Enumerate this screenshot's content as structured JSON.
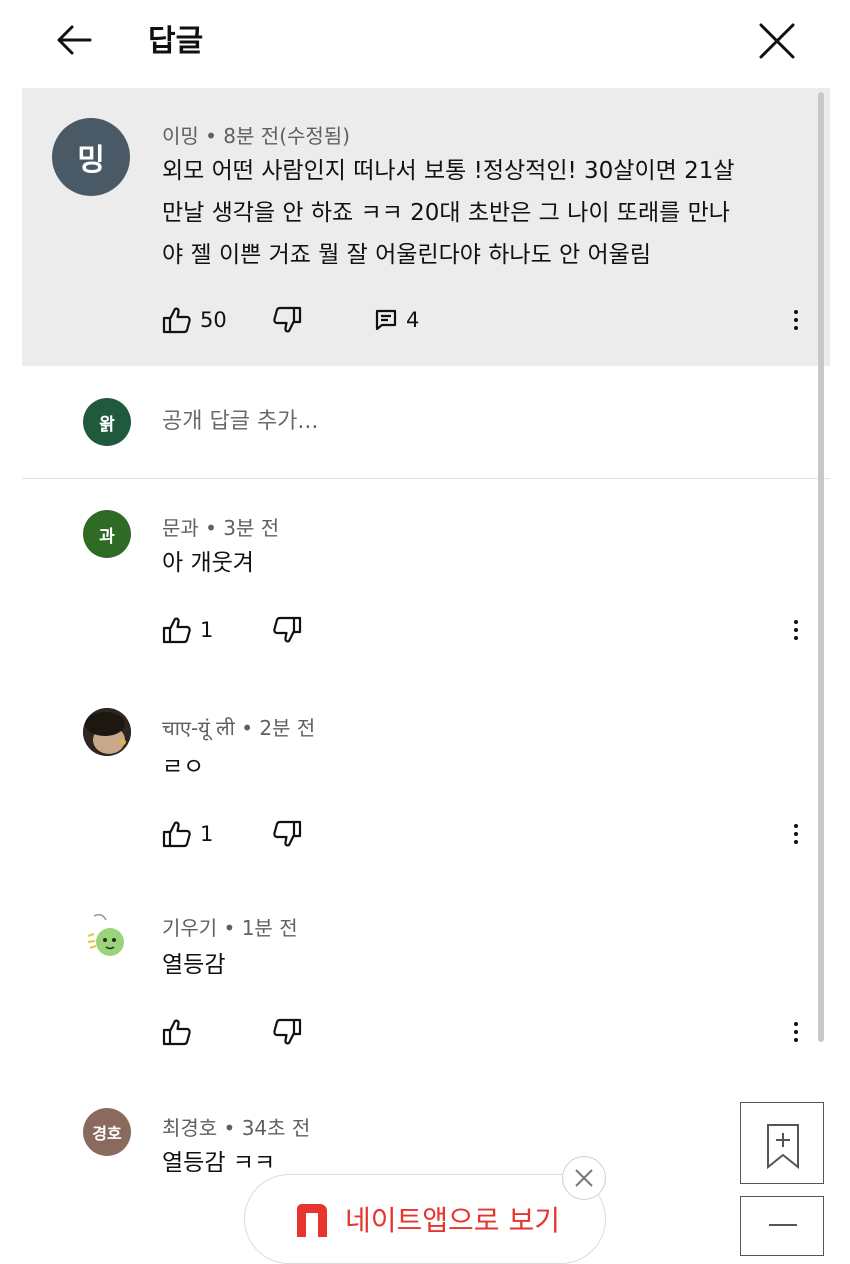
{
  "header": {
    "title": "답글"
  },
  "op": {
    "avatar_text": "밍",
    "avatar_color": "#4a5966",
    "meta": "이밍 • 8분 전(수정됨)",
    "lines": [
      "외모 어떤 사람인지 떠나서 보통 !정상적인! 30살이면 21살",
      "만날 생각을 안 하죠 ㅋㅋ 20대 초반은 그 나이 또래를 만나",
      "야 젤 이쁜 거죠 뭘 잘 어울린다야 하나도 안 어울림"
    ],
    "likes": "50",
    "replies": "4"
  },
  "reply_input": {
    "avatar_text": "왉",
    "avatar_color": "#1f5a3c",
    "placeholder": "공개 답글 추가..."
  },
  "comments": [
    {
      "avatar_text": "과",
      "avatar_color": "#2f6b25",
      "meta": "문과 • 3분 전",
      "text": "아 개웃겨",
      "likes": "1"
    },
    {
      "avatar_text": "",
      "avatar_icon": "photo-avatar",
      "meta": "चाए-यूं ली • 2분 전",
      "text": "ㄹㅇ",
      "likes": "1"
    },
    {
      "avatar_text": "",
      "avatar_icon": "green-character-avatar",
      "meta": "기우기 • 1분 전",
      "text": "열등감",
      "likes": ""
    },
    {
      "avatar_text": "경호",
      "avatar_color": "#8a6a5c",
      "meta": "최경호 • 34초 전",
      "text": "열등감 ㅋㅋ",
      "likes": ""
    }
  ],
  "banner": {
    "text": "네이트앱으로 보기",
    "color": "#e8342e"
  }
}
